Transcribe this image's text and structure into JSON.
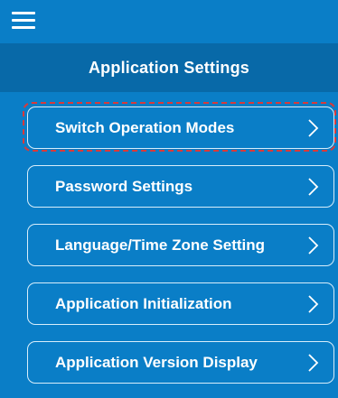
{
  "header": {
    "menu_icon": "hamburger-menu-icon",
    "title": "Application Settings"
  },
  "menu": {
    "items": [
      {
        "label": "Switch Operation Modes",
        "icon": "chevron-right-icon",
        "highlighted": true
      },
      {
        "label": "Password Settings",
        "icon": "chevron-right-icon",
        "highlighted": false
      },
      {
        "label": "Language/Time Zone Setting",
        "icon": "chevron-right-icon",
        "highlighted": false
      },
      {
        "label": "Application Initialization",
        "icon": "chevron-right-icon",
        "highlighted": false
      },
      {
        "label": "Application Version Display",
        "icon": "chevron-right-icon",
        "highlighted": false
      }
    ]
  },
  "colors": {
    "background": "#0a7ec7",
    "title_bar": "#0869a8",
    "button_border": "#d8eefb",
    "text": "#ffffff",
    "highlight_dash": "#d83a3a"
  }
}
